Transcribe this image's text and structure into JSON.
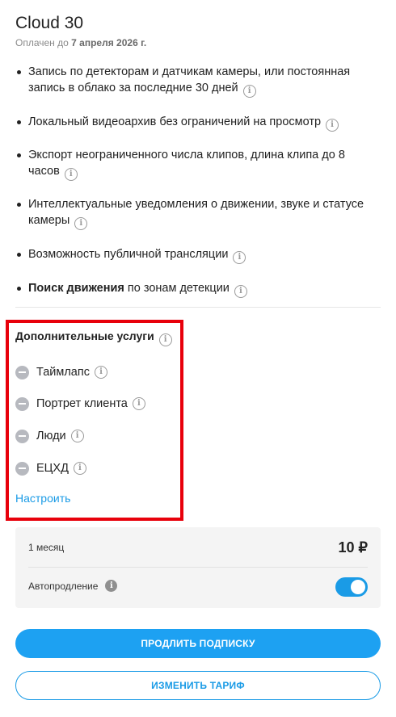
{
  "plan": {
    "title": "Cloud 30",
    "paid_prefix": "Оплачен до",
    "paid_date": "7 апреля 2026 г."
  },
  "features": [
    {
      "bold": "",
      "text": "Запись по детекторам и датчикам камеры, или постоянная запись в облако за последние 30 дней"
    },
    {
      "bold": "",
      "text": "Локальный видеоархив без ограничений на просмотр"
    },
    {
      "bold": "",
      "text": "Экспорт неограниченного числа клипов, длина клипа до 8 часов"
    },
    {
      "bold": "",
      "text": "Интеллектуальные уведомления о движении, звуке и статусе камеры"
    },
    {
      "bold": "",
      "text": "Возможность публичной трансляции"
    },
    {
      "bold": "Поиск движения",
      "text": " по зонам детекции"
    }
  ],
  "addons": {
    "title": "Дополнительные услуги",
    "items": [
      "Таймлапс",
      "Портрет клиента",
      "Люди",
      "ЕЦХД"
    ],
    "configure_label": "Настроить"
  },
  "pricing": {
    "period": "1 месяц",
    "price": "10 ₽",
    "autorenew_label": "Автопродление",
    "autorenew_on": true
  },
  "buttons": {
    "extend": "ПРОДЛИТЬ ПОДПИСКУ",
    "change": "ИЗМЕНИТЬ ТАРИФ"
  },
  "colors": {
    "accent": "#1da1f2",
    "highlight_box": "#e8000b"
  }
}
